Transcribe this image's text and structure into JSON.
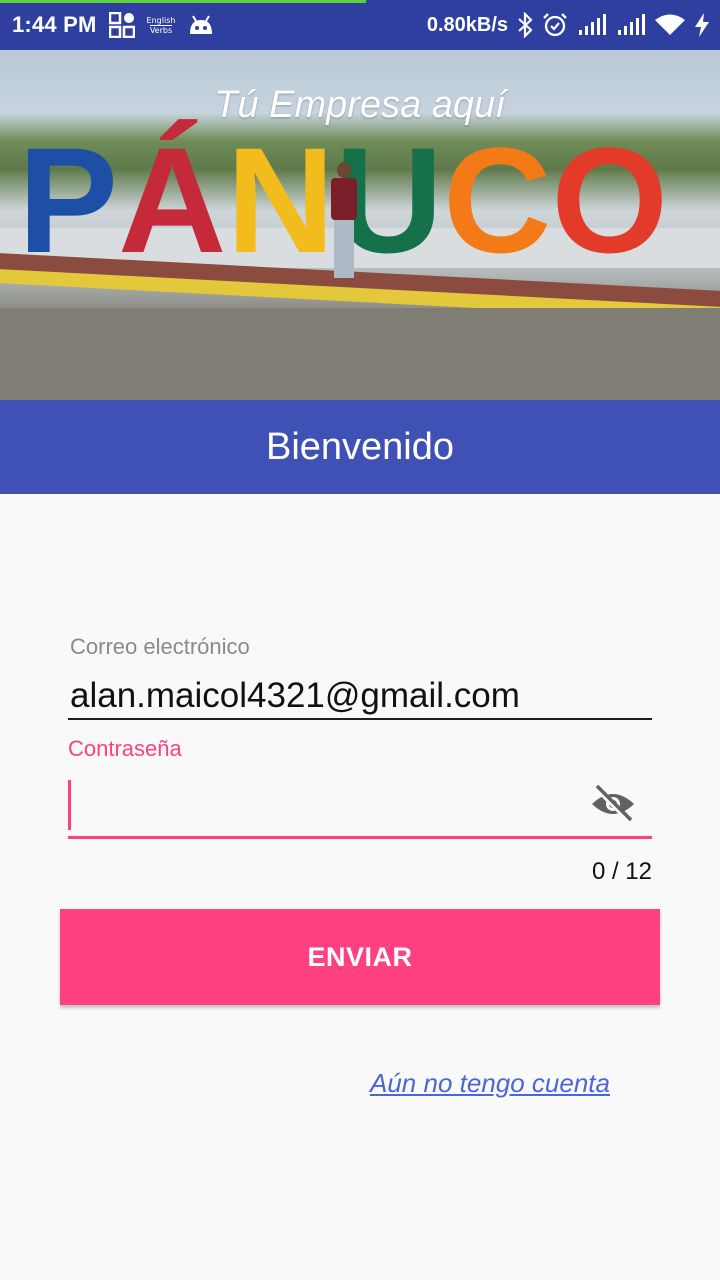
{
  "status_bar": {
    "time": "1:44 PM",
    "app_badge_line1": "English",
    "app_badge_line2": "Verbs",
    "net_speed": "0.80kB/s",
    "icons": [
      "qr-grid-icon",
      "english-verbs-badge-icon",
      "android-robot-icon",
      "bluetooth-icon",
      "alarm-icon",
      "signal-icon",
      "signal-icon",
      "wifi-icon",
      "charging-icon"
    ]
  },
  "hero": {
    "tagline": "Tú Empresa aquí",
    "letters": [
      "P",
      "Á",
      "N",
      "U",
      "C",
      "O"
    ]
  },
  "header": {
    "title": "Bienvenido"
  },
  "form": {
    "email_label": "Correo electrónico",
    "email_value": "alan.maicol4321@gmail.com",
    "password_label": "Contraseña",
    "password_value": "",
    "password_counter": "0 / 12",
    "submit_label": "ENVIAR",
    "no_account_link": "Aún no tengo cuenta"
  },
  "colors": {
    "primary": "#3f51b5",
    "status_bar": "#2f3fa0",
    "accent": "#ff4081",
    "link": "#4a66d8"
  }
}
